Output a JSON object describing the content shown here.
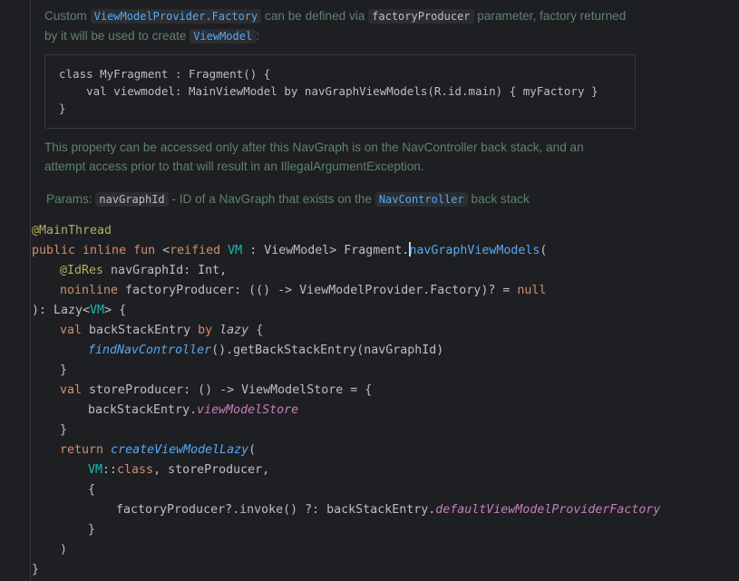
{
  "doc": {
    "para1_a": "Custom ",
    "para1_chip1": "ViewModelProvider.Factory",
    "para1_b": " can be defined via ",
    "para1_chip2": "factoryProducer",
    "para1_c": " parameter, factory returned",
    "para1_d": "by it will be used to create ",
    "para1_chip3": "ViewModel",
    "para1_e": ":",
    "example": {
      "line1": "class MyFragment : Fragment() {",
      "line2": "    val viewmodel: MainViewModel by navGraphViewModels(R.id.main) { myFactory }",
      "line3": "}"
    },
    "para2_line1": "This property can be accessed only after this NavGraph is on the NavController back stack, and an",
    "para2_line2": "attempt access prior to that will result in an IllegalArgumentException.",
    "params_label": "Params: ",
    "params_chip1": "navGraphId",
    "params_text": " - ID of a NavGraph that exists on the ",
    "params_chip2": "NavController",
    "params_text2": " back stack"
  },
  "code": {
    "l1_ann": "@MainThread",
    "l2_kw1": "public inline fun",
    "l2_a": " <",
    "l2_kw2": "reified",
    "l2_sp": " ",
    "l2_tp": "VM",
    "l2_b": " : ViewModel> Fragment.",
    "l2_fn": "navGraphViewModels",
    "l2_c": "(",
    "l3_ann": "@IdRes",
    "l3_a": " navGraphId: Int,",
    "l4_kw": "noinline",
    "l4_a": " factoryProducer: (() -> ViewModelProvider.Factory)? = ",
    "l4_null": "null",
    "l5_a": "): Lazy<",
    "l5_tp": "VM",
    "l5_b": "> {",
    "l6_kw": "val",
    "l6_a": " backStackEntry ",
    "l6_by": "by",
    "l6_sp": " ",
    "l6_lazy": "lazy",
    "l6_b": " {",
    "l7_fn": "findNavController",
    "l7_a": "().getBackStackEntry(navGraphId)",
    "l8": "}",
    "l9_kw": "val",
    "l9_a": " storeProducer: () -> ViewModelStore = {",
    "l10_a": "backStackEntry.",
    "l10_prop": "viewModelStore",
    "l11": "}",
    "l12_kw": "return",
    "l12_sp": " ",
    "l12_fn": "createViewModelLazy",
    "l12_a": "(",
    "l13_tp": "VM",
    "l13_a": "::",
    "l13_kw": "class",
    "l13_b": ", storeProducer,",
    "l14": "{",
    "l15_a": "factoryProducer?.invoke() ?: backStackEntry.",
    "l15_prop": "defaultViewModelProviderFactory",
    "l16": "}",
    "l17": ")",
    "l18": "}"
  }
}
